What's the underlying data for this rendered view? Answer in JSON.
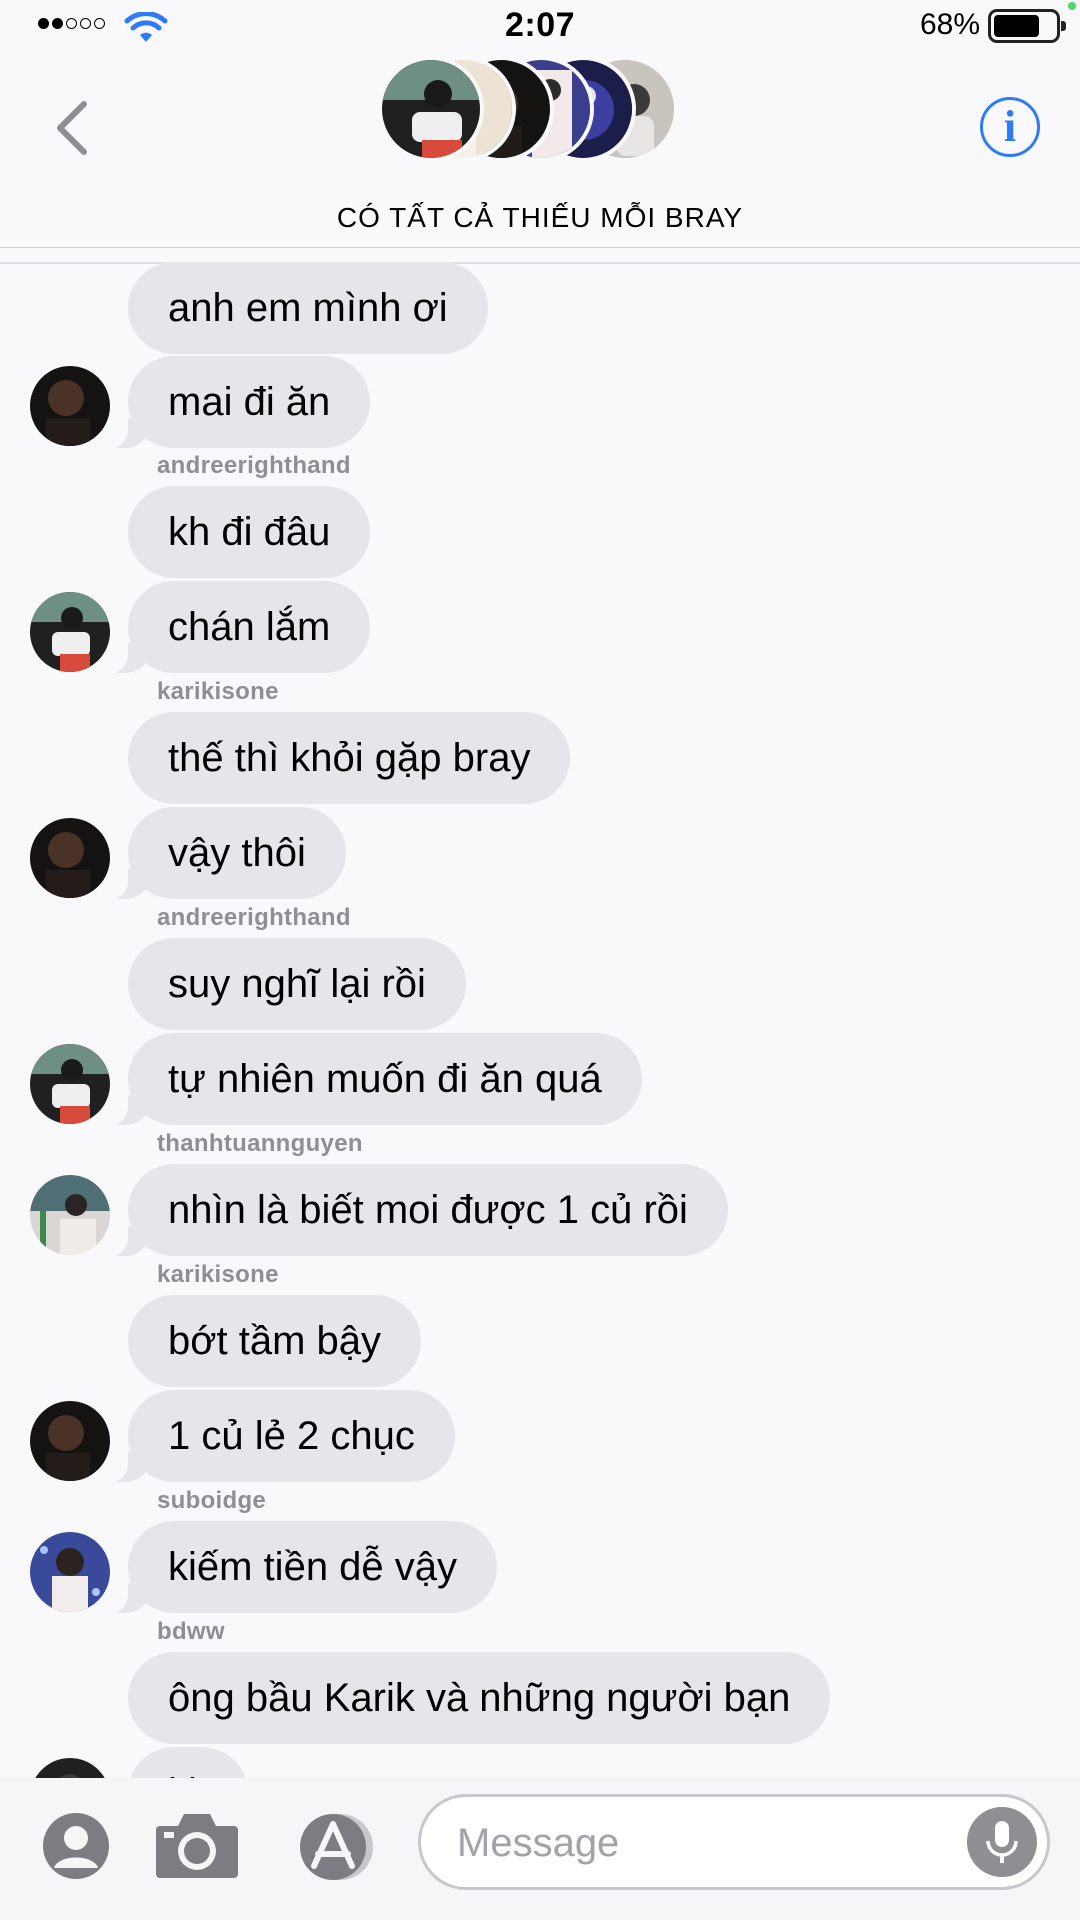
{
  "status_bar": {
    "time": "2:07",
    "battery_percent": "68%",
    "battery_level": 0.68,
    "signal_bars": 2,
    "signal_total": 5
  },
  "header": {
    "title": "CÓ TẤT CẢ THIẾU MỖI BRAY",
    "info_label": "i"
  },
  "colors": {
    "accent": "#2d7cf6",
    "bubble": "#e5e5ea",
    "sender_label": "#8e8e93",
    "background": "#f9f9fb"
  },
  "messages": [
    {
      "text": "anh em mình ơi"
    },
    {
      "text": "mai đi ăn"
    },
    {
      "sender": "andreerighthand",
      "text": "kh đi đâu"
    },
    {
      "text": "chán lắm"
    },
    {
      "sender": "karikisone",
      "text": "thế thì khỏi gặp bray"
    },
    {
      "text": "vậy thôi"
    },
    {
      "sender": "andreerighthand",
      "text": "suy nghĩ lại rồi"
    },
    {
      "text": "tự nhiên muốn đi ăn quá"
    },
    {
      "sender": "thanhtuannguyen",
      "text": "nhìn là biết moi được 1 củ rồi"
    },
    {
      "sender": "karikisone",
      "text": "bớt tầm bậy"
    },
    {
      "text": "1 củ lẻ 2 chục"
    },
    {
      "sender": "suboidge",
      "text": "kiếm tiền dễ vậy"
    },
    {
      "sender": "bdww",
      "text": "ông bầu Karik và những người bạn"
    },
    {
      "text": "kk"
    }
  ],
  "input": {
    "placeholder": "Message"
  },
  "icons": {
    "back": "chevron-left-icon",
    "info": "info-icon",
    "contact": "person-icon",
    "camera": "camera-icon",
    "apps": "app-store-icon",
    "mic": "microphone-icon"
  }
}
